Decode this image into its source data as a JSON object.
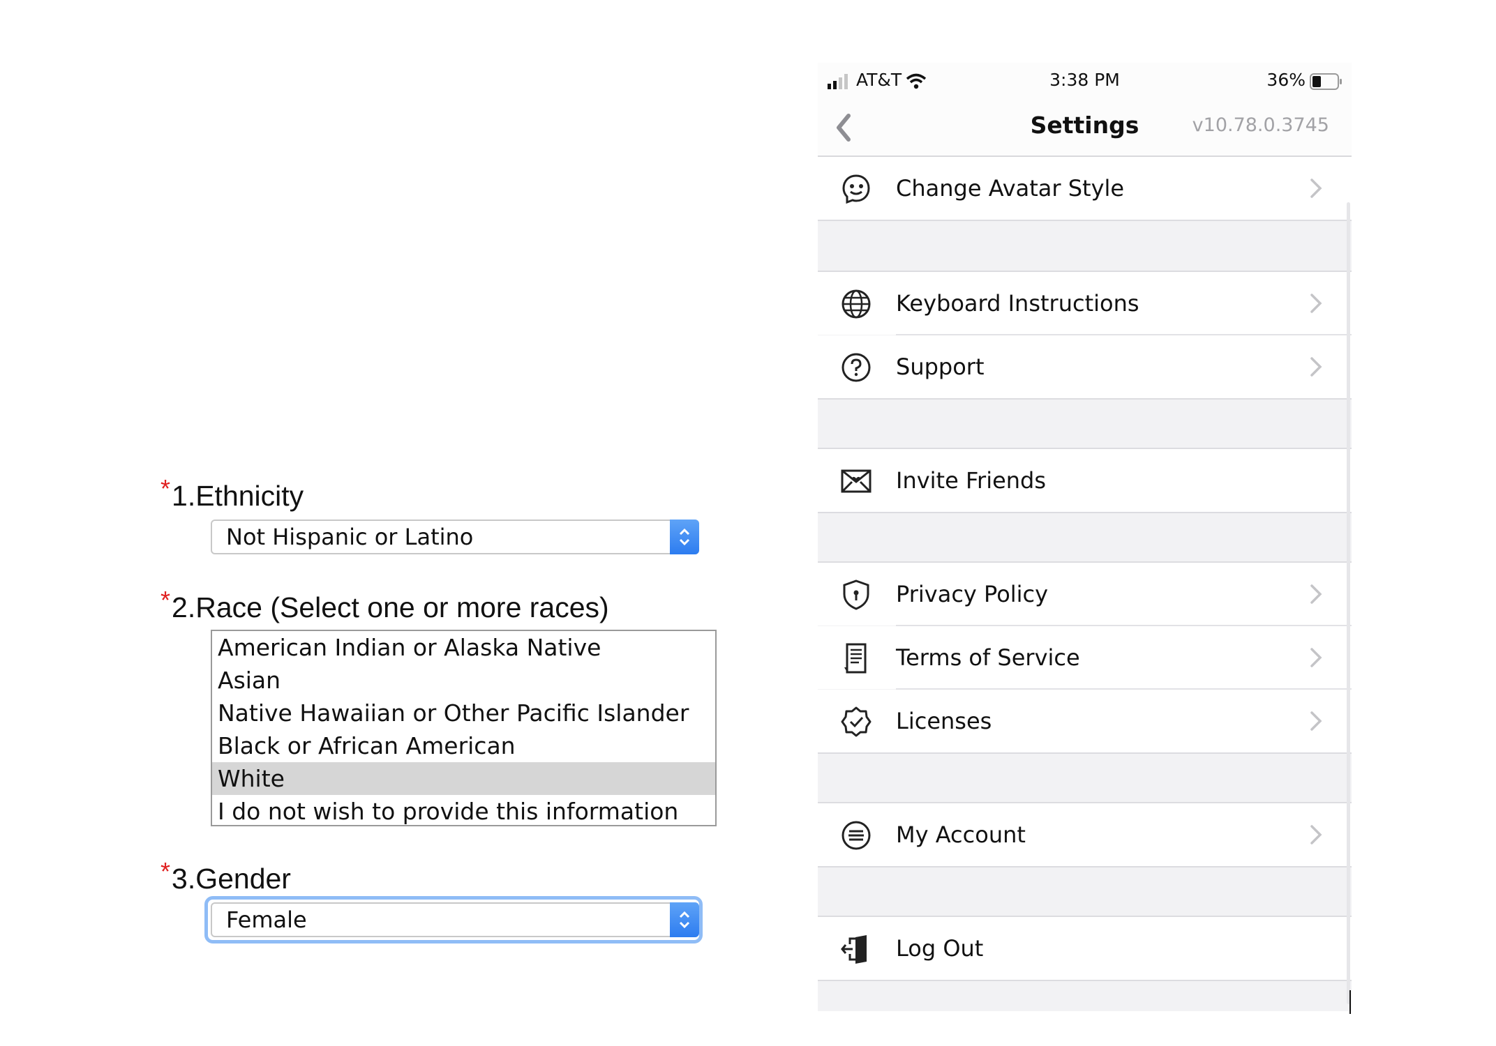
{
  "form": {
    "q1": {
      "required_mark": "*",
      "label": "1.Ethnicity",
      "value": "Not Hispanic or Latino"
    },
    "q2": {
      "required_mark": "*",
      "label": "2.Race (Select one or more races)",
      "options": [
        "American Indian or Alaska Native",
        "Asian",
        "Native Hawaiian or Other Pacific Islander",
        "Black or African American",
        "White",
        "I do not wish to provide this information"
      ],
      "selected": "White"
    },
    "q3": {
      "required_mark": "*",
      "label": "3.Gender",
      "value": "Female"
    }
  },
  "phone": {
    "status": {
      "carrier": "AT&T",
      "time": "3:38 PM",
      "battery": "36%",
      "battery_level": 0.36
    },
    "nav": {
      "title": "Settings",
      "version": "v10.78.0.3745"
    },
    "items": {
      "change_avatar": "Change Avatar Style",
      "keyboard": "Keyboard Instructions",
      "support": "Support",
      "invite": "Invite Friends",
      "privacy": "Privacy Policy",
      "terms": "Terms of Service",
      "licenses": "Licenses",
      "account": "My Account",
      "logout": "Log Out"
    }
  },
  "colors": {
    "accent": "#2d7cf0",
    "required": "#e02020",
    "group_bg": "#f2f2f4",
    "chevron": "#c4c4c7"
  }
}
